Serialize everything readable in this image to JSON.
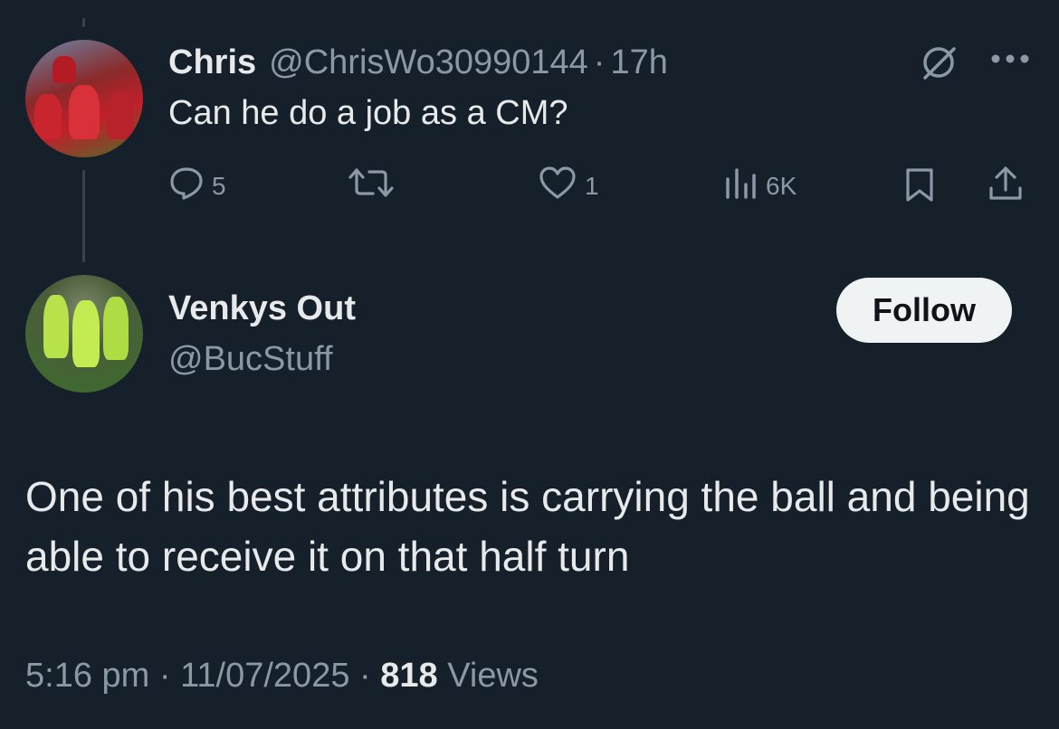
{
  "parent_tweet": {
    "author_name": "Chris",
    "author_handle": "@ChrisWo30990144",
    "separator": "·",
    "time_ago": "17h",
    "text": "Can he do a job as a CM?",
    "replies": "5",
    "likes": "1",
    "views": "6K",
    "icons": [
      "grok-icon",
      "more-icon",
      "reply-icon",
      "retweet-icon",
      "like-icon",
      "views-icon",
      "bookmark-icon",
      "share-icon"
    ]
  },
  "reply_tweet": {
    "author_name": "Venkys Out",
    "author_handle": "@BucStuff",
    "follow_label": "Follow",
    "text": "One of his best attributes is carrying the ball and being able to receive it on that half turn",
    "time": "5:16 pm",
    "sep1": "·",
    "date": "11/07/2025",
    "sep2": "·",
    "views_count": "818",
    "views_label": "Views"
  },
  "colors": {
    "background": "#15202b",
    "primary_text": "#e7e9ea",
    "secondary_text": "#8b98a5",
    "button_bg": "#eff3f4"
  }
}
